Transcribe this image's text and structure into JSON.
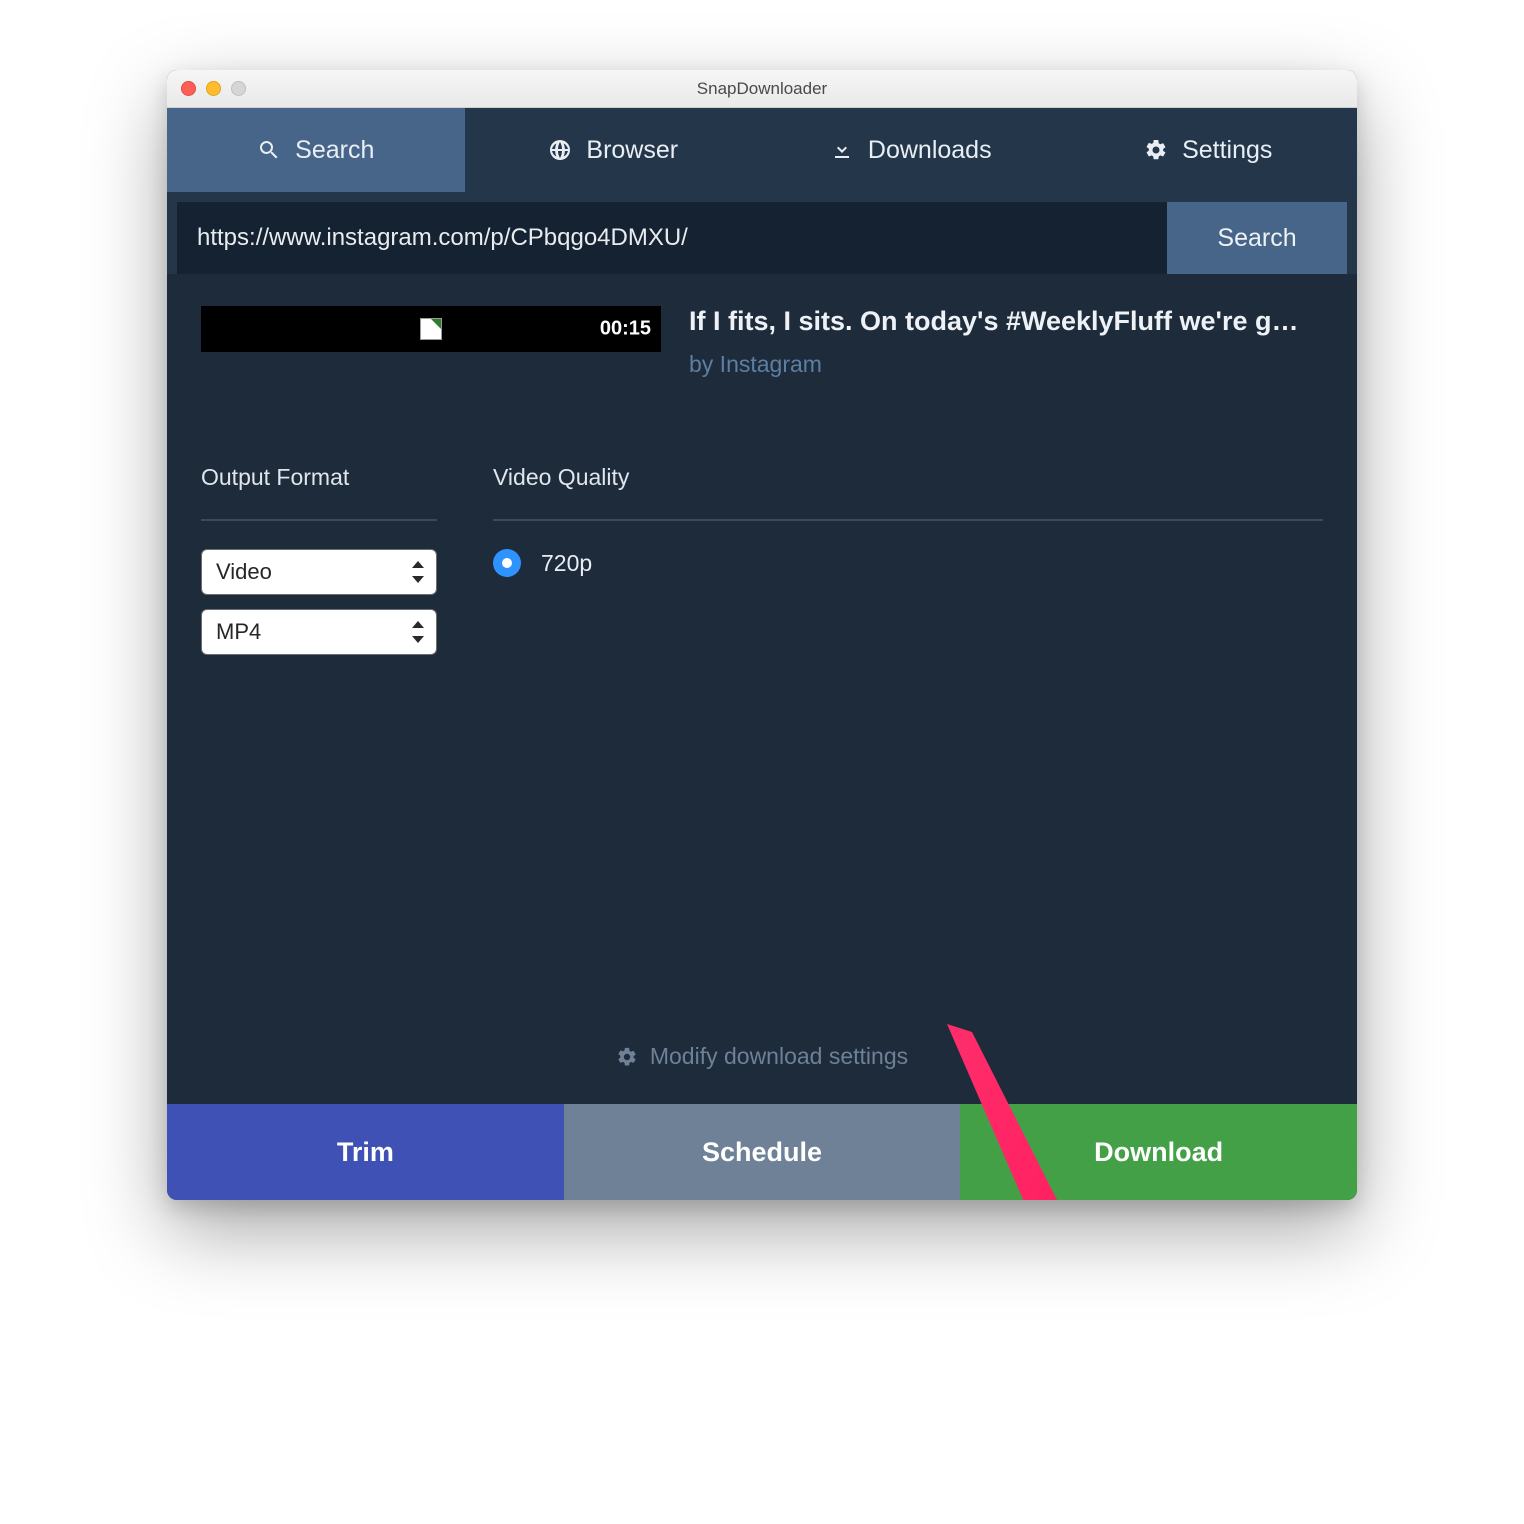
{
  "window": {
    "title": "SnapDownloader"
  },
  "tabs": {
    "search": "Search",
    "browser": "Browser",
    "downloads": "Downloads",
    "settings": "Settings"
  },
  "search": {
    "url_value": "https://www.instagram.com/p/CPbqgo4DMXU/",
    "button": "Search"
  },
  "video": {
    "duration": "00:15",
    "title": "If I fits, I sits. On today's #WeeklyFluff we're g…",
    "author": "by Instagram"
  },
  "options": {
    "format_label": "Output Format",
    "quality_label": "Video Quality",
    "format_type": "Video",
    "format_container": "MP4",
    "quality_selected": "720p"
  },
  "footer": {
    "modify": "Modify download settings",
    "trim": "Trim",
    "schedule": "Schedule",
    "download": "Download"
  }
}
